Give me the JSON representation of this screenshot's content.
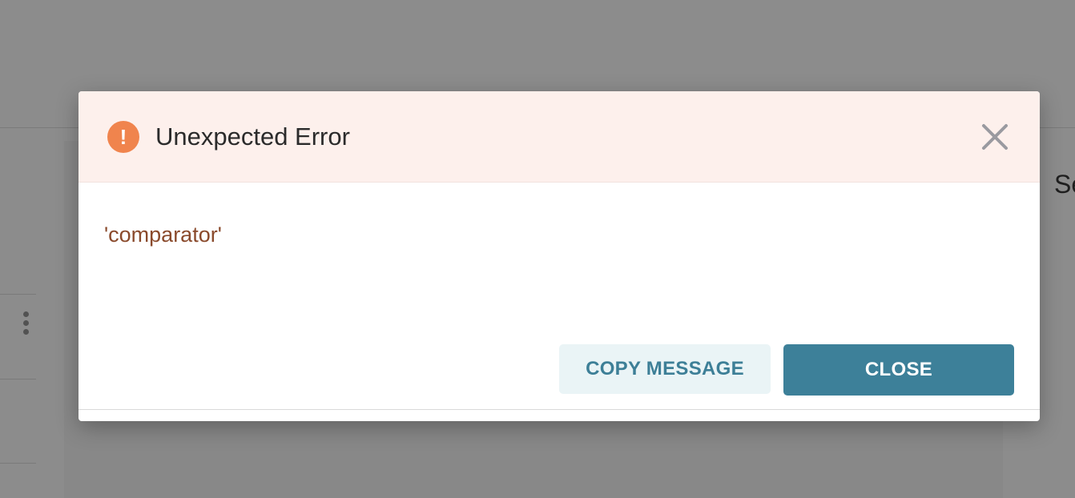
{
  "background": {
    "right_panel_title": "Se"
  },
  "dialog": {
    "title": "Unexpected Error",
    "icon": "exclamation-icon",
    "icon_glyph": "!",
    "message": "'comparator'",
    "buttons": {
      "copy_label": "COPY MESSAGE",
      "close_label": "CLOSE"
    }
  },
  "colors": {
    "header_bg": "#fdf0ec",
    "icon_accent": "#f0844d",
    "message_text": "#8a4a2c",
    "primary_button": "#3d8099",
    "secondary_button_bg": "#eaf4f6"
  }
}
